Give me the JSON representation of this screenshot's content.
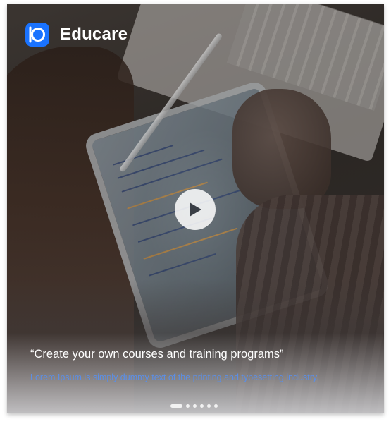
{
  "brand": {
    "name": "Educare",
    "logo_icon": "educare-logo-icon",
    "logo_color": "#1a73ff"
  },
  "video": {
    "play_icon": "play-icon"
  },
  "hero": {
    "headline": "“Create your own courses and training programs”",
    "subtext": "Lorem Ipsum is simply dummy text of the printing and typesetting industry.",
    "subtext_color": "#5b8ee6"
  },
  "pagination": {
    "count": 6,
    "active_index": 0
  }
}
